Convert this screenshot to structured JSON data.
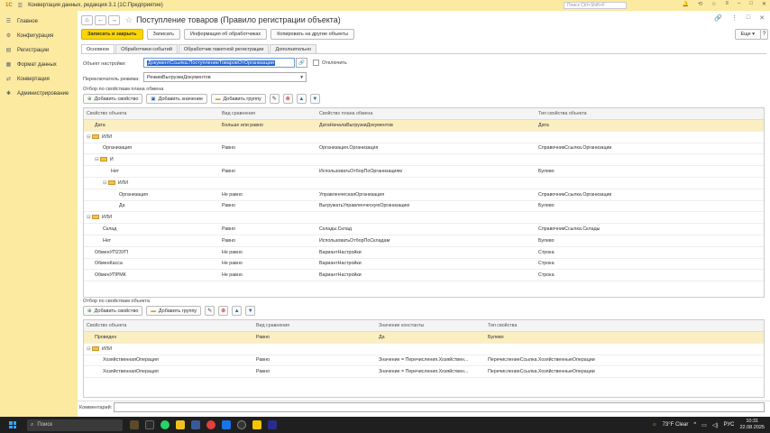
{
  "window": {
    "title": "Конвертация данных, редакция 3.1  (1С:Предприятие)",
    "search_placeholder": "Поиск Ctrl+Shift+F"
  },
  "sidebar": {
    "items": [
      {
        "label": "Главное",
        "icon": "list-icon"
      },
      {
        "label": "Конфигурация",
        "icon": "gear-icon"
      },
      {
        "label": "Регистрации",
        "icon": "book-icon"
      },
      {
        "label": "Формат данных",
        "icon": "grid-icon"
      },
      {
        "label": "Конвертация",
        "icon": "sync-icon"
      },
      {
        "label": "Администрирование",
        "icon": "settings-icon"
      }
    ]
  },
  "page": {
    "title": "Поступление товаров (Правило регистрации объекта)"
  },
  "toolbar": {
    "save_close": "Записать и закрыть",
    "save": "Записать",
    "handlers_info": "Информация об обработчиках",
    "copy_to_others": "Копировать на другие объекты",
    "more": "Еще",
    "help": "?"
  },
  "tabs": [
    "Основное",
    "Обработчики событий",
    "Обработчик пакетной регистрации",
    "Дополнительно"
  ],
  "form": {
    "settings_object_label": "Объект настройки:",
    "settings_object_value": "ДокументСсылка.ПоступлениеТоваровОтОрганизации",
    "disabled_label": "Отключить",
    "mode_label": "Переключатель режима:",
    "mode_value": "РежимВыгрузкиДокументов"
  },
  "exchange_section": {
    "title": "Отбор по свойствам плана обмена",
    "add_property": "Добавить свойство",
    "add_value": "Добавить значение",
    "add_group": "Добавить группу",
    "columns": [
      "Свойство объекта",
      "Вид сравнения",
      "Свойство плана обмена",
      "Тип свойства объекта"
    ],
    "rows": [
      {
        "c": [
          "Дата",
          "Больше или равно",
          "ДатаНачалаВыгрузкиДокументов",
          "Дата"
        ],
        "indent": 0,
        "folder": false,
        "selected": true
      },
      {
        "c": [
          "ИЛИ",
          "",
          "",
          ""
        ],
        "indent": 0,
        "folder": true
      },
      {
        "c": [
          "Организация",
          "Равно",
          "Организация.Организация",
          "СправочникСсылка.Организации"
        ],
        "indent": 1,
        "folder": false
      },
      {
        "c": [
          "И",
          "",
          "",
          ""
        ],
        "indent": 1,
        "folder": true
      },
      {
        "c": [
          "Нет",
          "Равно",
          "ИспользоватьОтборПоОрганизациям",
          "Булево"
        ],
        "indent": 2,
        "folder": false
      },
      {
        "c": [
          "ИЛИ",
          "",
          "",
          ""
        ],
        "indent": 2,
        "folder": true
      },
      {
        "c": [
          "Организация",
          "Не равно",
          "УправленческаяОрганизация",
          "СправочникСсылка.Организации"
        ],
        "indent": 3,
        "folder": false
      },
      {
        "c": [
          "Да",
          "Равно",
          "ВыгружатьУправленческуюОрганизацию",
          "Булево"
        ],
        "indent": 3,
        "folder": false
      },
      {
        "c": [
          "ИЛИ",
          "",
          "",
          ""
        ],
        "indent": 0,
        "folder": true
      },
      {
        "c": [
          "Склад",
          "Равно",
          "Склады.Склад",
          "СправочникСсылка.Склады"
        ],
        "indent": 1,
        "folder": false
      },
      {
        "c": [
          "Нет",
          "Равно",
          "ИспользоватьОтборПоСкладам",
          "Булево"
        ],
        "indent": 1,
        "folder": false
      },
      {
        "c": [
          "ОбменУП2ЗУП",
          "Не равно",
          "ВариантНастройки",
          "Строка"
        ],
        "indent": 0,
        "folder": false
      },
      {
        "c": [
          "ОбменКасса",
          "Не равно",
          "ВариантНастройки",
          "Строка"
        ],
        "indent": 0,
        "folder": false
      },
      {
        "c": [
          "ОбменУПРМК",
          "Не равно",
          "ВариантНастройки",
          "Строка"
        ],
        "indent": 0,
        "folder": false
      }
    ]
  },
  "object_section": {
    "title": "Отбор по свойствам объекта",
    "add_property": "Добавить свойство",
    "add_group": "Добавить группу",
    "columns": [
      "Свойство объекта",
      "Вид сравнения",
      "Значение константы",
      "Тип свойства"
    ],
    "rows": [
      {
        "c": [
          "Проведен",
          "Равно",
          "Да",
          "Булево"
        ],
        "indent": 0,
        "folder": false,
        "selected": true
      },
      {
        "c": [
          "ИЛИ",
          "",
          "",
          ""
        ],
        "indent": 0,
        "folder": true
      },
      {
        "c": [
          "ХозяйственнаяОперация",
          "Равно",
          "Значение = Перечисления.Хозяйствен...",
          "ПеречислениеСсылка.ХозяйственныеОперации"
        ],
        "indent": 1,
        "folder": false
      },
      {
        "c": [
          "ХозяйственнаяОперация",
          "Равно",
          "Значение = Перечисления.Хозяйствен...",
          "ПеречислениеСсылка.ХозяйственныеОперации"
        ],
        "indent": 1,
        "folder": false
      }
    ]
  },
  "comment_label": "Комментарий:",
  "taskbar": {
    "search": "Поиск",
    "weather": "73°F  Clear",
    "lang": "РУС",
    "time": "10:31",
    "date": "22.08.2025"
  }
}
